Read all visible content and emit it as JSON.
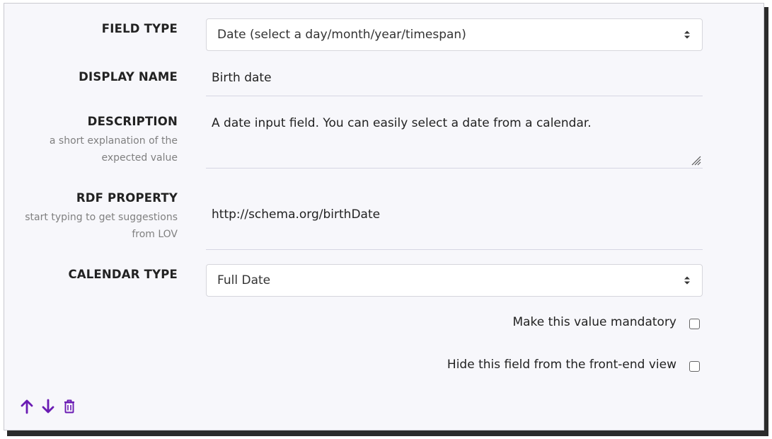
{
  "form": {
    "field_type": {
      "label": "FIELD TYPE",
      "value": "Date (select a day/month/year/timespan)"
    },
    "display_name": {
      "label": "DISPLAY NAME",
      "value": "Birth date"
    },
    "description": {
      "label": "DESCRIPTION",
      "hint": "a short explanation of the expected value",
      "value": "A date input field. You can easily select a date from a calendar."
    },
    "rdf_property": {
      "label": "RDF PROPERTY",
      "hint": "start typing to get suggestions from LOV",
      "value": "http://schema.org/birthDate"
    },
    "calendar_type": {
      "label": "CALENDAR TYPE",
      "value": "Full Date"
    },
    "mandatory": {
      "label": "Make this value mandatory",
      "checked": false
    },
    "hide_front_end": {
      "label": "Hide this field from the front-end view",
      "checked": false
    }
  },
  "actions": {
    "icons": [
      "arrow-up-icon",
      "arrow-down-icon",
      "trash-icon"
    ],
    "color": "#6a1bb3"
  },
  "colors": {
    "background": "#f7f7fb",
    "accent": "#6a1bb3"
  }
}
